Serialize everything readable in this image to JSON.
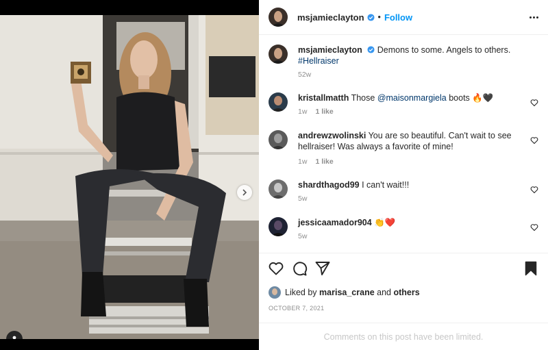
{
  "post": {
    "author": "msjamieclayton",
    "follow_label": "Follow",
    "dot": "•",
    "caption_user": "msjamieclayton",
    "caption_text": "Demons to some. Angels to others.",
    "caption_hashtag": "#Hellraiser",
    "caption_age": "52w"
  },
  "comments": [
    {
      "user": "kristallmatth",
      "pre": "Those ",
      "mention": "@maisonmargiela",
      "post": " boots 🔥🖤",
      "age": "1w",
      "likes": "1 like"
    },
    {
      "user": "andrewzwolinski",
      "text": "You are so beautiful. Can't wait to see hellraiser! Was always a favorite of mine!",
      "age": "1w",
      "likes": "1 like"
    },
    {
      "user": "shardthagod99",
      "text": "I can't wait!!!",
      "age": "5w"
    },
    {
      "user": "jessicaamador904",
      "text": "👏❤️",
      "age": "5w"
    }
  ],
  "likes": {
    "prefix": "Liked by",
    "user": "marisa_crane",
    "conj": "and",
    "others": "others"
  },
  "date": "OCTOBER 7, 2021",
  "limited_notice": "Comments on this post have been limited.",
  "icons": {
    "like": "heart-icon",
    "comment": "comment-icon",
    "share": "paper-plane-icon",
    "save": "bookmark-icon",
    "more": "more-horizontal-icon",
    "next": "chevron-right-icon",
    "tags": "user-tag-icon"
  },
  "colors": {
    "accent": "#0095f6",
    "link": "#00376b",
    "muted": "#8e8e8e"
  }
}
